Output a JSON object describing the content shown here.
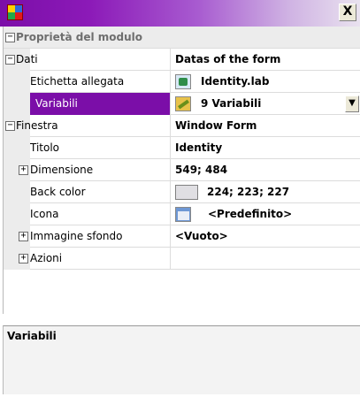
{
  "window": {
    "close_glyph": "X"
  },
  "grid": {
    "section_title": "Proprietà del modulo",
    "categories": {
      "dati": "Dati",
      "dati_value": "Datas of the form",
      "finestra": "Finestra",
      "finestra_value": "Window Form"
    },
    "rows": {
      "etichetta": {
        "label": "Etichetta allegata",
        "value": "Identity.lab"
      },
      "variabili": {
        "label": "Variabili",
        "value": "9 Variabili"
      },
      "titolo": {
        "label": "Titolo",
        "value": "Identity"
      },
      "dimensione": {
        "label": "Dimensione",
        "value": "549; 484"
      },
      "backcolor": {
        "label": "Back color",
        "value": "224; 223; 227"
      },
      "icona": {
        "label": "Icona",
        "value": "<Predefinito>"
      },
      "immagine": {
        "label": "Immagine sfondo",
        "value": "<Vuoto>"
      },
      "azioni": {
        "label": "Azioni",
        "value": ""
      }
    },
    "expand_collapsed": "+",
    "expand_open": "−",
    "dropdown_glyph": "▼"
  },
  "description": {
    "title": "Variabili"
  },
  "colors": {
    "accent": "#7b0ea8",
    "back_color_swatch": "#e0dfe3"
  },
  "icons": {
    "app": "app-icon",
    "lab": "label-file-icon",
    "variables": "variables-icon",
    "form": "form-icon"
  }
}
